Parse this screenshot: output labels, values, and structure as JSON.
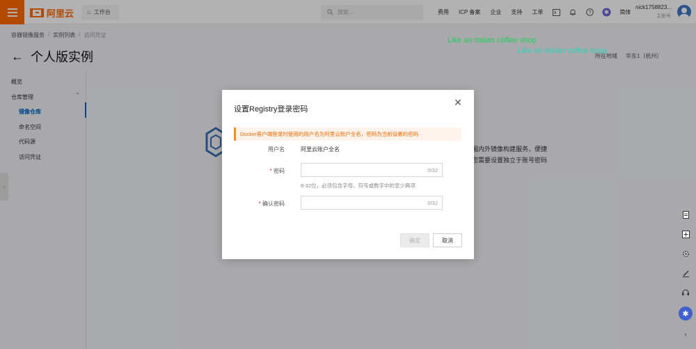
{
  "topbar": {
    "logo_text": "阿里云",
    "workbench_label": "工作台",
    "search_placeholder": "搜索...",
    "links": [
      "费用",
      "ICP 备案",
      "企业",
      "支持",
      "工单"
    ],
    "lang_label": "简体",
    "user_name": "nick1758823...",
    "user_role": "主账号"
  },
  "breadcrumb": [
    "容器镜像服务",
    "实例列表",
    "访问凭证"
  ],
  "page_title": "个人版实例",
  "region": {
    "label": "所在地域",
    "value": "华东1（杭州）"
  },
  "sidebar": {
    "overview": "概览",
    "group_label": "仓库管理",
    "items": [
      "镜像仓库",
      "命名空间",
      "代码源",
      "访问凭证"
    ]
  },
  "background": {
    "line1": "国内外镜像构建服务，便捷",
    "line2": "您需要设置独立于账号密码"
  },
  "watermark": "Like an Italian coffee shop",
  "modal": {
    "title": "设置Registry登录密码",
    "alert": "Docker客户端登录时使用的用户名为阿里云账户全名，密码为当前设置的密码",
    "username_label": "用户名",
    "username_value": "阿里云账户全名",
    "password_label": "密码",
    "password_counter": "0/32",
    "password_hint": "8-32位，必须包含字母、符号或数字中的至少两项",
    "confirm_label": "确认密码",
    "confirm_counter": "0/32",
    "ok_label": "确定",
    "cancel_label": "取消"
  },
  "colors": {
    "brand": "#ff6a00",
    "primary": "#0064c8",
    "required": "#e0302d"
  }
}
